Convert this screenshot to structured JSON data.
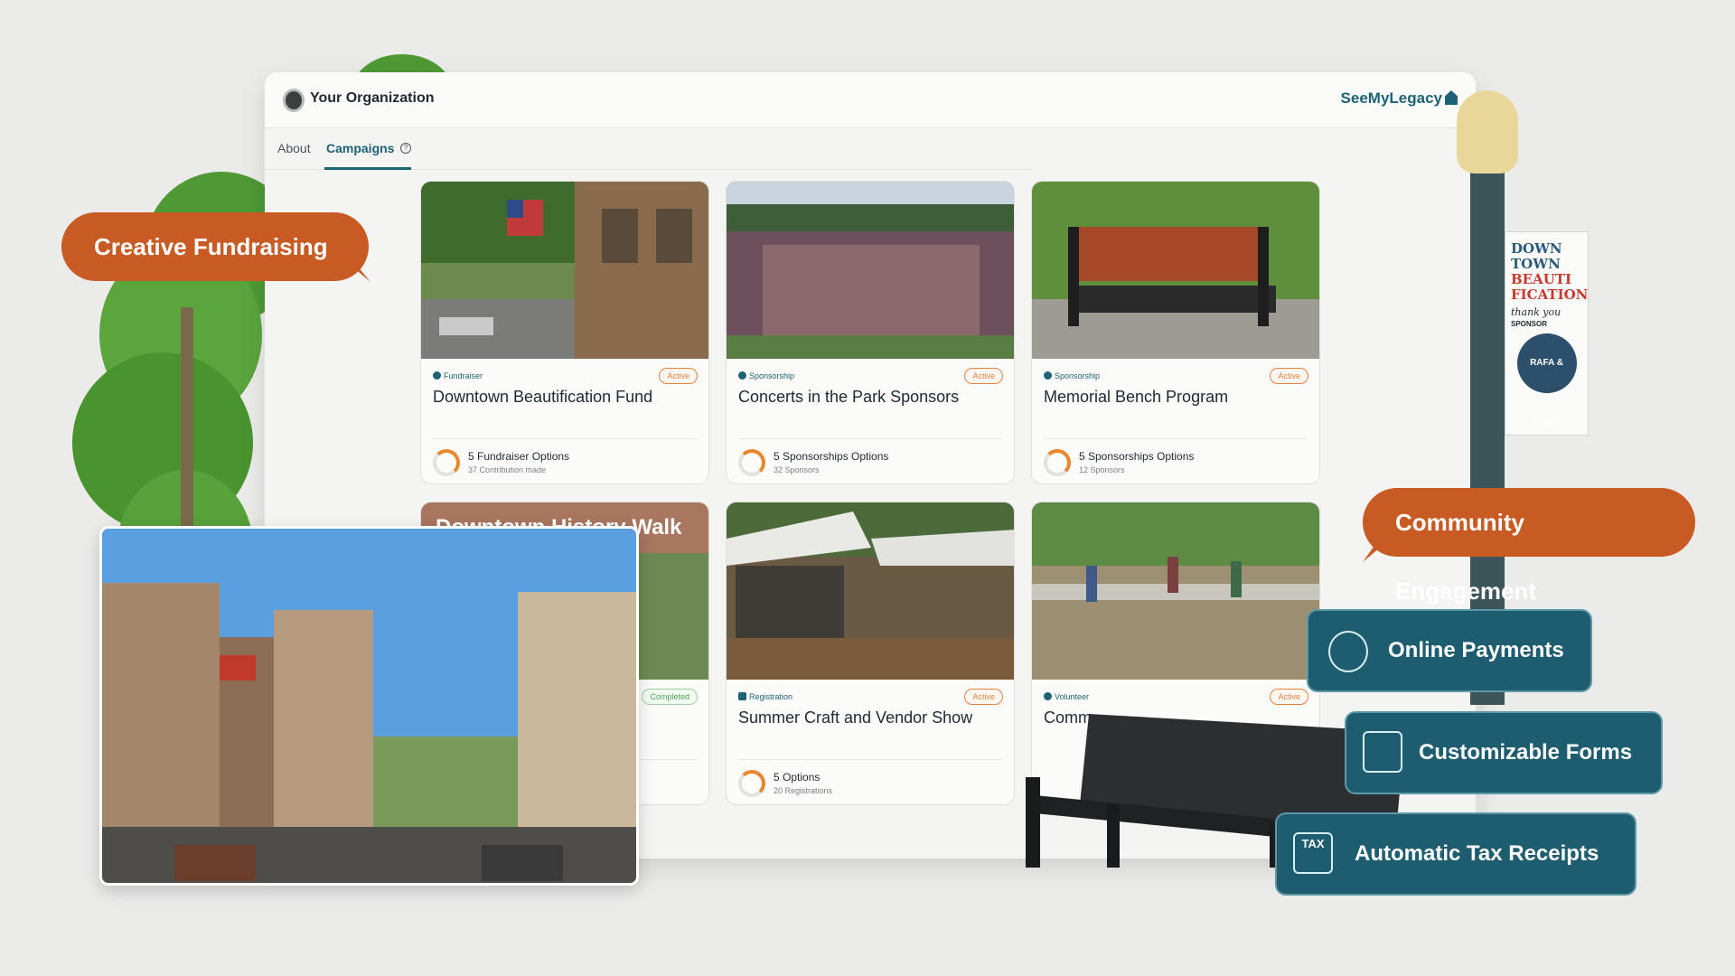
{
  "app": {
    "org_name": "Your Organization",
    "brand": "SeeMyLegacy",
    "tabs": {
      "about": "About",
      "campaigns": "Campaigns"
    }
  },
  "cards": [
    {
      "type": "Fundraiser",
      "status": "Active",
      "title": "Downtown Beautification Fund",
      "options": "5 Fundraiser Options",
      "sub": "37 Contribution made"
    },
    {
      "type": "Sponsorship",
      "status": "Active",
      "title": "Concerts in the Park Sponsors",
      "options": "5 Sponsorships Options",
      "sub": "32 Sponsors"
    },
    {
      "type": "Sponsorship",
      "status": "Active",
      "title": "Memorial Bench Program",
      "options": "5 Sponsorships Options",
      "sub": "12 Sponsors"
    },
    {
      "type": "",
      "status": "Completed",
      "title": "",
      "overlay_title": "Downtown History Walk",
      "options": "",
      "sub": ""
    },
    {
      "type": "Registration",
      "status": "Active",
      "title": "Summer Craft and Vendor Show",
      "options": "5 Options",
      "sub": "20 Registrations"
    },
    {
      "type": "Volunteer",
      "status": "Active",
      "title": "Comm",
      "options": "",
      "sub": ""
    }
  ],
  "overlays": {
    "creative_fundraising": "Creative Fundraising",
    "community_engagement": "Community Engagement",
    "online_payments": "Online Payments",
    "customizable_forms": "Customizable Forms",
    "automatic_tax_receipts": "Automatic Tax Receipts",
    "tax_icon_text": "TAX"
  },
  "banner": {
    "line1": "DOWN",
    "line2": "TOWN",
    "line3": "BEAUTI",
    "line4": "FICATION",
    "thanks": "thank you",
    "sponsor": "SPONSOR",
    "seal": "RAFA & SONS"
  },
  "icons": {
    "org_logo": "org-logo-icon",
    "help": "help-icon",
    "payments": "hand-money-icon",
    "forms": "form-list-icon",
    "tax": "tax-receipt-icon"
  },
  "colors": {
    "accent": "#1e6276",
    "bubble": "#c85a23",
    "feature": "#1e5d70",
    "active": "#e4813f",
    "completed": "#4f9f5b"
  }
}
